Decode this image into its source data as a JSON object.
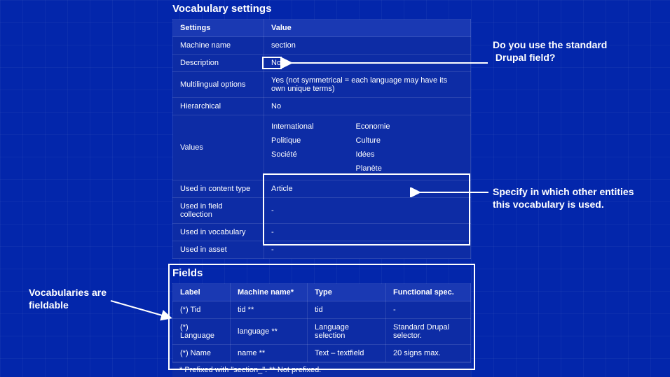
{
  "sections": {
    "settings": {
      "title": "Vocabulary settings",
      "headers": [
        "Settings",
        "Value"
      ],
      "rows": [
        {
          "k": "Machine name",
          "v": "section"
        },
        {
          "k": "Description",
          "v": "No"
        },
        {
          "k": "Multilingual options",
          "v": "Yes (not symmetrical = each language may have its own unique terms)"
        },
        {
          "k": "Hierarchical",
          "v": "No"
        }
      ],
      "values_label": "Values",
      "values": {
        "col1": [
          "International",
          "Politique",
          "Société"
        ],
        "col2": [
          "Economie",
          "Culture",
          "Idées",
          "Planète"
        ]
      },
      "used_rows": [
        {
          "k": "Used in content type",
          "v": "Article"
        },
        {
          "k": "Used in field collection",
          "v": "-"
        },
        {
          "k": "Used in vocabulary",
          "v": "-"
        },
        {
          "k": "Used in asset",
          "v": "-"
        }
      ]
    },
    "fields": {
      "title": "Fields",
      "headers": [
        "Label",
        "Machine name*",
        "Type",
        "Functional spec."
      ],
      "rows": [
        {
          "label": "(*) Tid",
          "mn": "tid **",
          "type": "tid",
          "spec": "-"
        },
        {
          "label": "(*) Language",
          "mn": "language **",
          "type": "Language selection",
          "spec": "Standard Drupal selector."
        },
        {
          "label": "(*) Name",
          "mn": "name **",
          "type": "Text – textfield",
          "spec": "20 signs max."
        }
      ],
      "footnote": "* Prefixed with \"section_\". ** Not prefixed."
    }
  },
  "callouts": {
    "standard_field": "Do you use the standard\n Drupal field?",
    "entities": "Specify in which other entities\nthis vocabulary is used.",
    "fieldable": "Vocabularies are\nfieldable"
  }
}
